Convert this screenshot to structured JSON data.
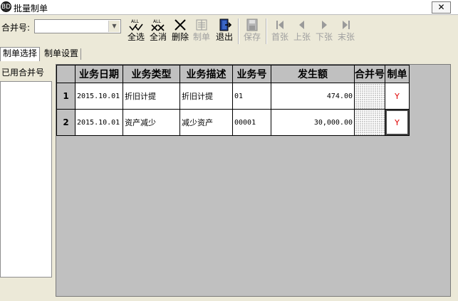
{
  "window": {
    "title": "批量制单",
    "icon_text": "BD",
    "close_icon": "close-icon"
  },
  "toolbar": {
    "merge_label": "合并号:",
    "merge_value": "",
    "buttons": [
      {
        "id": "select-all",
        "label": "全选",
        "icon": "check-all-icon",
        "enabled": true
      },
      {
        "id": "deselect-all",
        "label": "全消",
        "icon": "uncheck-all-icon",
        "enabled": true
      },
      {
        "id": "delete",
        "label": "删除",
        "icon": "delete-x-icon",
        "enabled": true
      },
      {
        "id": "make-voucher",
        "label": "制单",
        "icon": "voucher-icon",
        "enabled": false
      },
      {
        "id": "exit",
        "label": "退出",
        "icon": "exit-door-icon",
        "enabled": true
      },
      {
        "id": "save",
        "label": "保存",
        "icon": "floppy-disk-icon",
        "enabled": false
      },
      {
        "id": "first",
        "label": "首张",
        "icon": "first-page-icon",
        "enabled": false
      },
      {
        "id": "prev",
        "label": "上张",
        "icon": "prev-page-icon",
        "enabled": false
      },
      {
        "id": "next",
        "label": "下张",
        "icon": "next-page-icon",
        "enabled": false
      },
      {
        "id": "last",
        "label": "末张",
        "icon": "last-page-icon",
        "enabled": false
      }
    ]
  },
  "tabs": [
    {
      "label": "制单选择",
      "active": true
    },
    {
      "label": "制单设置",
      "active": false
    }
  ],
  "left_panel": {
    "label": "已用合并号"
  },
  "grid": {
    "columns": [
      "业务日期",
      "业务类型",
      "业务描述",
      "业务号",
      "发生额",
      "合并号",
      "制单"
    ],
    "rows": [
      {
        "no": "1",
        "date": "2015.10.01",
        "type": "折旧计提",
        "desc": "折旧计提",
        "number": "01",
        "amount": "474.00",
        "merge": "",
        "mark": "Y"
      },
      {
        "no": "2",
        "date": "2015.10.01",
        "type": "资产减少",
        "desc": "减少资产",
        "number": "00001",
        "amount": "30,000.00",
        "merge": "",
        "mark": "Y"
      }
    ]
  },
  "colors": {
    "mark_red": "#e00000",
    "grid_bg": "#c0c0c0",
    "window_bg": "#ece9d8"
  }
}
